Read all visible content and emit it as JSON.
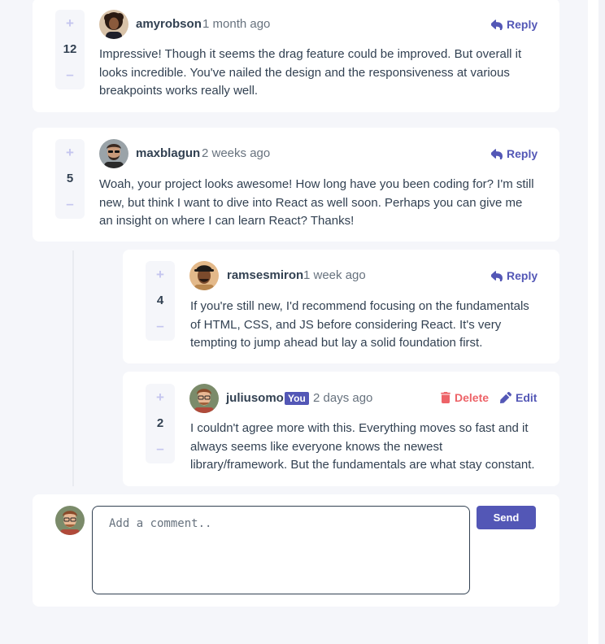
{
  "comments": [
    {
      "score": "12",
      "username": "amyrobson",
      "time": "1 month ago",
      "action": "Reply",
      "content": "Impressive! Though it seems the drag feature could be improved. But overall it looks incredible. You've nailed the design and the responsiveness at various breakpoints works really well."
    },
    {
      "score": "5",
      "username": "maxblagun",
      "time": "2 weeks ago",
      "action": "Reply",
      "content": "Woah, your project looks awesome! How long have you been coding for? I'm still new, but think I want to dive into React as well soon. Perhaps you can give me an insight on where I can learn React? Thanks!"
    }
  ],
  "replies": [
    {
      "score": "4",
      "username": "ramsesmiron",
      "time": "1 week ago",
      "action": "Reply",
      "content": "If you're still new, I'd recommend focusing on the fundamentals of HTML, CSS, and JS before considering React. It's very tempting to jump ahead but lay a solid foundation first."
    },
    {
      "score": "2",
      "username": "juliusomo",
      "badge": "You",
      "time": "2 days ago",
      "delete_label": "Delete",
      "edit_label": "Edit",
      "content": "I couldn't agree more with this. Everything moves so fast and it always seems like everyone knows the newest library/framework. But the fundamentals are what stay constant."
    }
  ],
  "controls": {
    "plus": "+",
    "minus": "–"
  },
  "composer": {
    "placeholder": "Add a comment..",
    "send_label": "Send"
  },
  "colors": {
    "primary": "#5357b6",
    "danger": "#ed6368",
    "vote_icon": "#c5c6ef"
  },
  "icons": [
    "plus-icon",
    "minus-icon",
    "reply-icon",
    "delete-icon",
    "edit-icon",
    "avatar"
  ]
}
